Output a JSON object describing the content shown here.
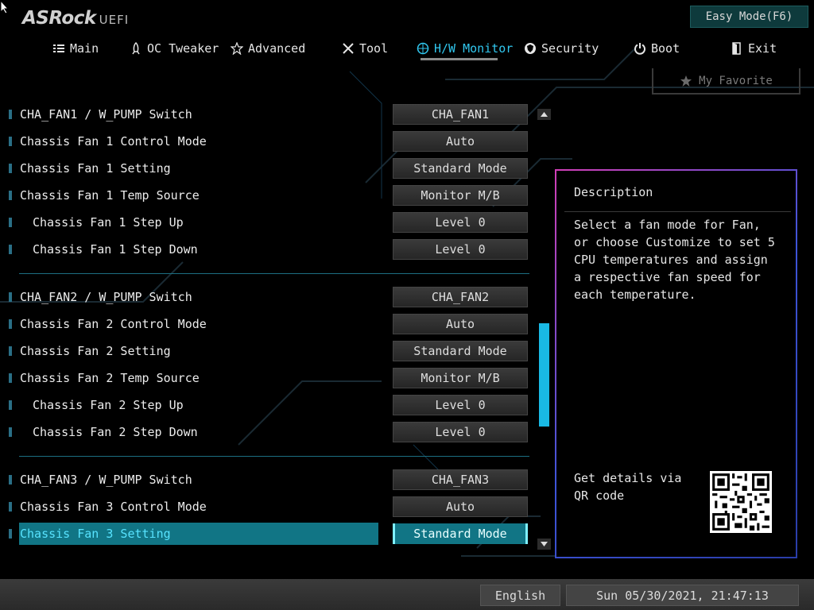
{
  "header": {
    "brand": "ASRock",
    "product": "UEFI",
    "easy_mode_label": "Easy Mode(F6)",
    "favorite_label": "My Favorite"
  },
  "nav": {
    "active": "H/W Monitor",
    "tabs": [
      {
        "label": "Main",
        "icon": "list-icon"
      },
      {
        "label": "OC Tweaker",
        "icon": "rocket-icon"
      },
      {
        "label": "Advanced",
        "icon": "star-icon"
      },
      {
        "label": "Tool",
        "icon": "tools-icon"
      },
      {
        "label": "H/W Monitor",
        "icon": "monitor-icon"
      },
      {
        "label": "Security",
        "icon": "shield-icon"
      },
      {
        "label": "Boot",
        "icon": "power-icon"
      },
      {
        "label": "Exit",
        "icon": "exit-icon"
      }
    ]
  },
  "settings": [
    {
      "label": "CHA_FAN1 / W_PUMP Switch",
      "value": "CHA_FAN1"
    },
    {
      "label": "Chassis Fan 1 Control Mode",
      "value": "Auto"
    },
    {
      "label": "Chassis Fan 1 Setting",
      "value": "Standard Mode"
    },
    {
      "label": "Chassis Fan 1 Temp Source",
      "value": "Monitor M/B"
    },
    {
      "label": "Chassis Fan 1 Step Up",
      "value": "Level 0"
    },
    {
      "label": "Chassis Fan 1 Step Down",
      "value": "Level 0"
    },
    {
      "label": "CHA_FAN2 / W_PUMP Switch",
      "value": "CHA_FAN2"
    },
    {
      "label": "Chassis Fan 2 Control Mode",
      "value": "Auto"
    },
    {
      "label": "Chassis Fan 2 Setting",
      "value": "Standard Mode"
    },
    {
      "label": "Chassis Fan 2 Temp Source",
      "value": "Monitor M/B"
    },
    {
      "label": "Chassis Fan 2 Step Up",
      "value": "Level 0"
    },
    {
      "label": "Chassis Fan 2 Step Down",
      "value": "Level 0"
    },
    {
      "label": "CHA_FAN3 / W_PUMP Switch",
      "value": "CHA_FAN3"
    },
    {
      "label": "Chassis Fan 3 Control Mode",
      "value": "Auto"
    },
    {
      "label": "Chassis Fan 3 Setting",
      "value": "Standard Mode",
      "selected": true
    }
  ],
  "description": {
    "title": "Description",
    "text": "Select a fan mode for Fan, or choose Customize to set 5 CPU temperatures and assign a respective fan speed for each temperature.",
    "qr_text": "Get details via QR code"
  },
  "footer": {
    "language": "English",
    "datetime": "Sun 05/30/2021, 21:47:13"
  },
  "colors": {
    "accent": "#31c8f0",
    "selection": "#117585",
    "easy_mode_bg": "#0e3a3c"
  }
}
